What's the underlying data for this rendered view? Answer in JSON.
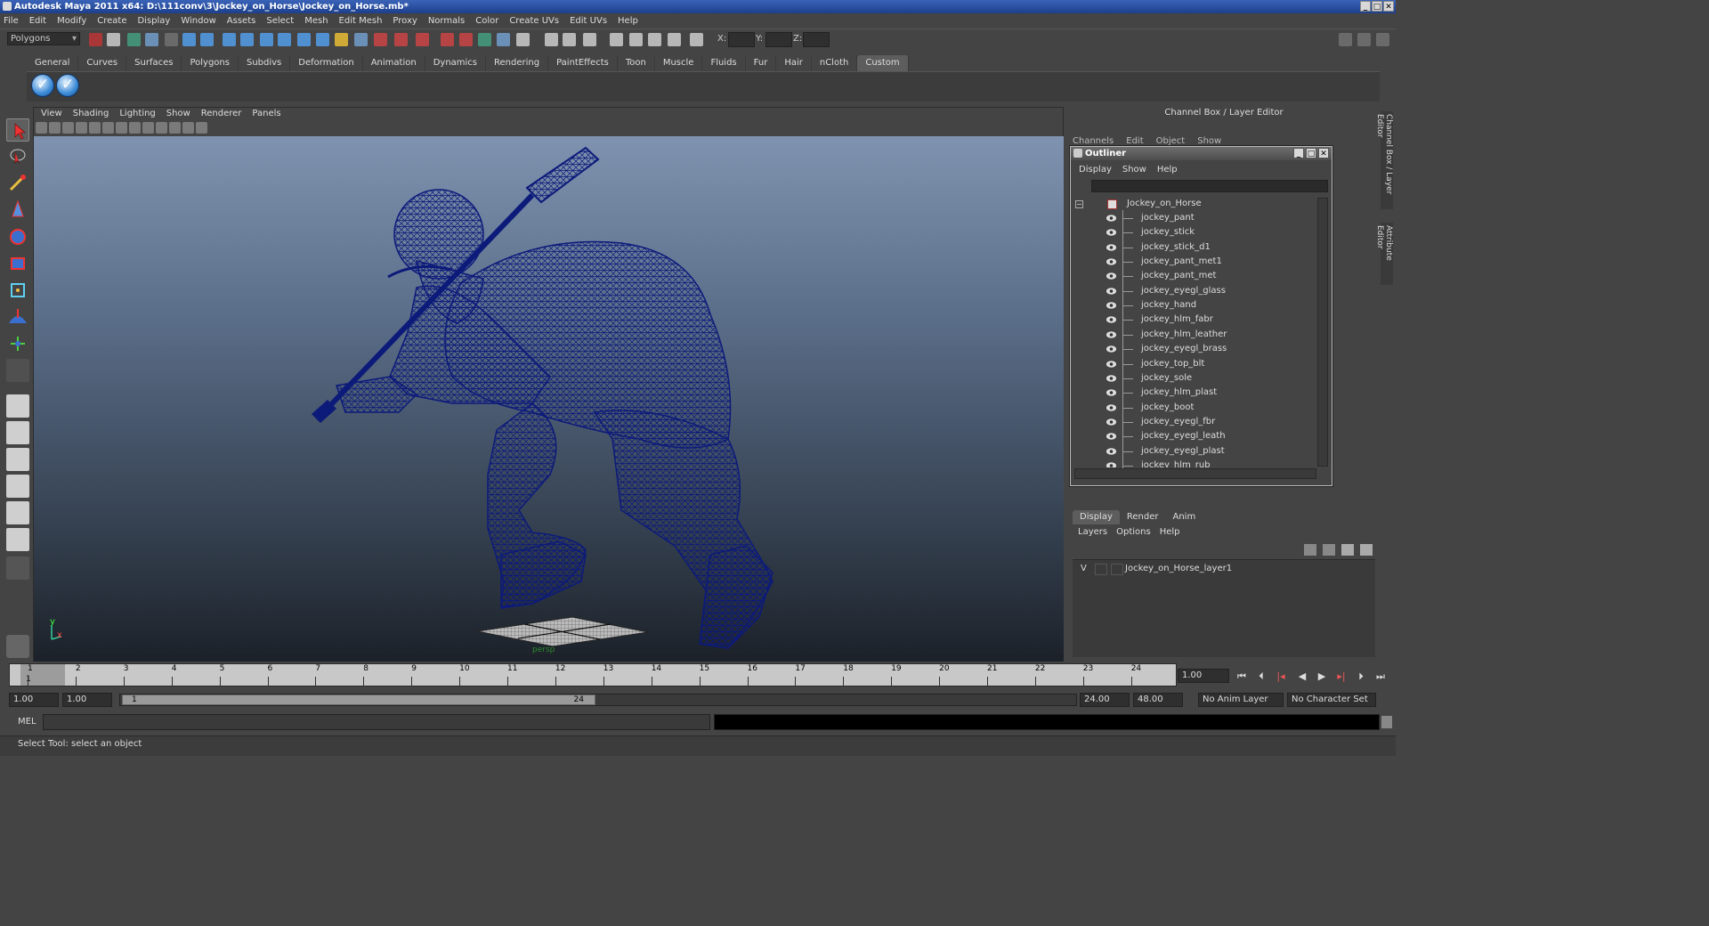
{
  "window": {
    "title": "Autodesk Maya 2011 x64: D:\\111conv\\3\\Jockey_on_Horse\\Jockey_on_Horse.mb*"
  },
  "menubar": [
    "File",
    "Edit",
    "Modify",
    "Create",
    "Display",
    "Window",
    "Assets",
    "Select",
    "Mesh",
    "Edit Mesh",
    "Proxy",
    "Normals",
    "Color",
    "Create UVs",
    "Edit UVs",
    "Help"
  ],
  "statusline": {
    "mode": "Polygons",
    "x_label": "X:",
    "y_label": "Y:",
    "z_label": "Z:"
  },
  "shelf_tabs": [
    "General",
    "Curves",
    "Surfaces",
    "Polygons",
    "Subdivs",
    "Deformation",
    "Animation",
    "Dynamics",
    "Rendering",
    "PaintEffects",
    "Toon",
    "Muscle",
    "Fluids",
    "Fur",
    "Hair",
    "nCloth",
    "Custom"
  ],
  "shelf_active": "Custom",
  "viewport": {
    "menu": [
      "View",
      "Shading",
      "Lighting",
      "Show",
      "Renderer",
      "Panels"
    ],
    "camera_label": "persp",
    "axis_x": "x",
    "axis_y": "y"
  },
  "channel_box": {
    "title": "Channel Box / Layer Editor",
    "tabs": [
      "Channels",
      "Edit",
      "Object",
      "Show"
    ]
  },
  "outliner": {
    "title": "Outliner",
    "menu": [
      "Display",
      "Show",
      "Help"
    ],
    "root": "Jockey_on_Horse",
    "items": [
      "jockey_pant",
      "jockey_stick",
      "jockey_stick_d1",
      "jockey_pant_met1",
      "jockey_pant_met",
      "jockey_eyegl_glass",
      "jockey_hand",
      "jockey_hlm_fabr",
      "jockey_hlm_leather",
      "jockey_eyegl_brass",
      "jockey_top_blt",
      "jockey_sole",
      "jockey_hlm_plast",
      "jockey_boot",
      "jockey_eyegl_fbr",
      "jockey_eyegl_leath",
      "jockey_eyegl_plast",
      "jockey_hlm_rub"
    ]
  },
  "layer_editor": {
    "tabs": [
      "Display",
      "Render",
      "Anim"
    ],
    "active_tab": "Display",
    "menu": [
      "Layers",
      "Options",
      "Help"
    ],
    "layer": {
      "visible": "V",
      "name": "Jockey_on_Horse_layer1"
    }
  },
  "side_tabs": [
    "Channel Box / Layer Editor",
    "Attribute Editor"
  ],
  "timeline": {
    "frames": [
      "1",
      "2",
      "3",
      "4",
      "5",
      "6",
      "7",
      "8",
      "9",
      "10",
      "11",
      "12",
      "13",
      "14",
      "15",
      "16",
      "17",
      "18",
      "19",
      "20",
      "21",
      "22",
      "23",
      "24"
    ],
    "current_frame_marker": "1",
    "current_time": "1.00"
  },
  "range": {
    "start": "1.00",
    "playback_start": "1.00",
    "slider_start": "1",
    "slider_end": "24",
    "playback_end": "24.00",
    "end": "48.00",
    "anim_layer": "No Anim Layer",
    "character_set": "No Character Set"
  },
  "command_line": {
    "label": "MEL"
  },
  "help_line": "Select Tool: select an object",
  "colors": {
    "wireframe": "#0c1a7a",
    "title_bar": "#2a4fa0",
    "panel_bg": "#444444"
  }
}
